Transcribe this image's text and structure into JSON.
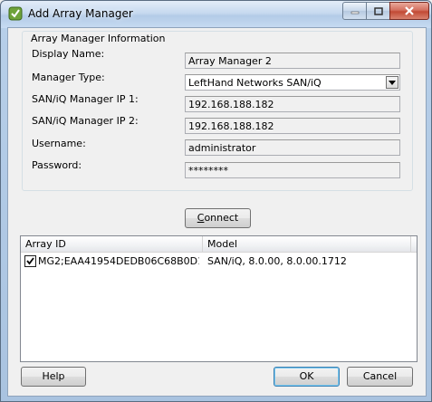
{
  "window": {
    "title": "Add Array Manager",
    "controls": [
      "minimize",
      "maximize",
      "close"
    ]
  },
  "group": {
    "legend": "Array Manager Information",
    "fields": [
      {
        "label": "Display Name:",
        "value": "Array Manager 2"
      },
      {
        "label": "Manager Type:",
        "value": "LeftHand Networks SAN/iQ"
      },
      {
        "label": "SAN/iQ Manager IP 1:",
        "value": "192.168.188.182"
      },
      {
        "label": "SAN/iQ Manager IP 2:",
        "value": "192.168.188.182"
      },
      {
        "label": "Username:",
        "value": "administrator"
      },
      {
        "label": "Password:",
        "value": "********"
      }
    ]
  },
  "connect_button": {
    "label_accel": "C",
    "label_rest": "onnect"
  },
  "table": {
    "columns": [
      "Array ID",
      "Model"
    ],
    "rows": [
      {
        "checked": true,
        "array_id": "MG2;EAA41954DEDB06C68B0D13...",
        "model": "SAN/iQ, 8.0.00, 8.0.00.1712"
      }
    ]
  },
  "footer": {
    "help": "Help",
    "ok": "OK",
    "cancel": "Cancel"
  },
  "colors": {
    "title_gradient": "#c6d9ef",
    "close_button": "#c24a35",
    "dialog_bg": "#f0f0f0"
  }
}
